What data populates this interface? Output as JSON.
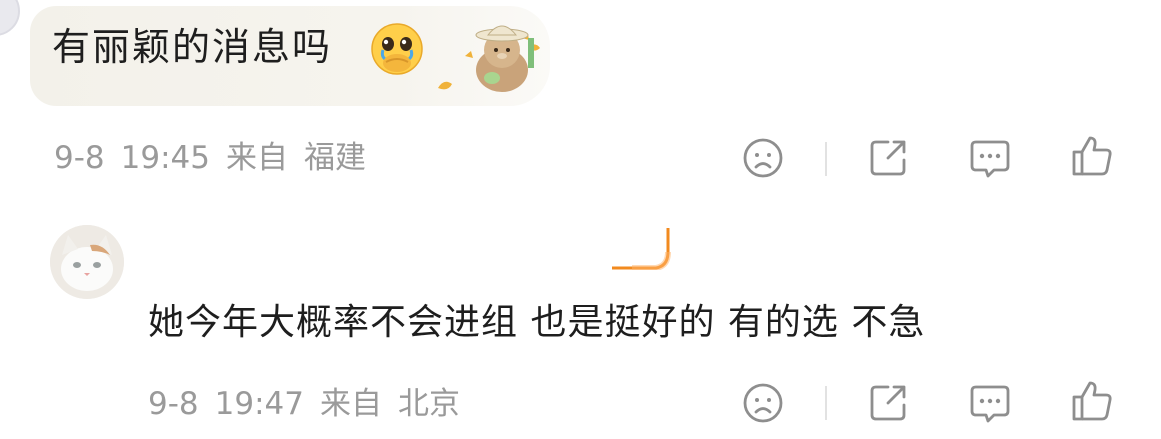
{
  "comments": [
    {
      "text": "有丽颖的消息吗",
      "emoji": "crying-pleading-face-emoji",
      "sticker": "bear-with-hat-sticker",
      "date": "9-8",
      "time": "19:45",
      "from_label": "来自",
      "location": "福建"
    },
    {
      "text": "她今年大概率不会进组 也是挺好的 有的选 不急",
      "avatar": "white-cat-avatar",
      "date": "9-8",
      "time": "19:47",
      "from_label": "来自",
      "location": "北京"
    }
  ],
  "icons": {
    "react": "sad-face-icon",
    "share": "share-icon",
    "comment": "comment-icon",
    "like": "thumbs-up-icon"
  },
  "colors": {
    "meta_text": "#9a9a9a",
    "icon_stroke": "#8e8e8e",
    "bubble_bg": "#f4f2ec",
    "emoji_yellow": "#ffcf4a",
    "accent_orange": "#f28a1e"
  }
}
